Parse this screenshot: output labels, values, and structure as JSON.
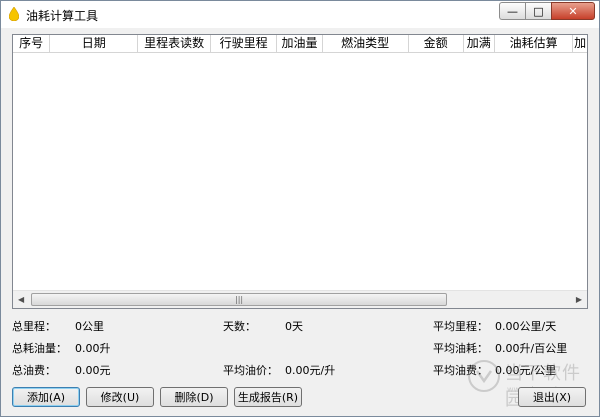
{
  "window": {
    "title": "油耗计算工具",
    "min": "—",
    "max": "□",
    "close": "✕"
  },
  "table": {
    "columns": [
      "序号",
      "日期",
      "里程表读数",
      "行驶里程",
      "加油量",
      "燃油类型",
      "金额",
      "加满",
      "油耗估算",
      "加"
    ],
    "rows": []
  },
  "scrollbar": {
    "left": "◀",
    "right": "▶",
    "grip": "|||"
  },
  "stats": {
    "total_mileage_label": "总里程：",
    "total_mileage": "0公里",
    "days_label": "天数：",
    "days": "0天",
    "avg_mileage_label": "平均里程：",
    "avg_mileage": "0.00公里/天",
    "total_fuel_label": "总耗油量：",
    "total_fuel": "0.00升",
    "avg_consumption_label": "平均油耗：",
    "avg_consumption": "0.00升/百公里",
    "total_cost_label": "总油费：",
    "total_cost": "0.00元",
    "avg_price_label": "平均油价：",
    "avg_price": "0.00元/升",
    "avg_cost_label": "平均油费：",
    "avg_cost": "0.00元/公里"
  },
  "buttons": {
    "add": "添加(A)",
    "edit": "修改(U)",
    "delete": "删除(D)",
    "report": "生成报告(R)",
    "exit": "退出(X)"
  },
  "watermark": {
    "text": "当下软件园",
    "sub": "www.downxia.com"
  }
}
